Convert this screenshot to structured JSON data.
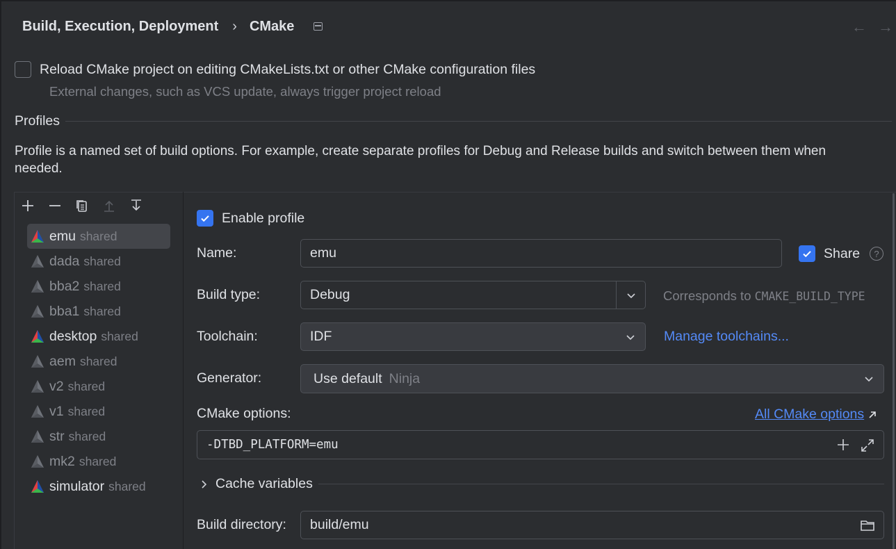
{
  "header": {
    "breadcrumb_parent": "Build, Execution, Deployment",
    "breadcrumb_sep": "›",
    "breadcrumb_current": "CMake",
    "back_arrow": "←",
    "forward_arrow": "→"
  },
  "reload": {
    "label": "Reload CMake project on editing CMakeLists.txt or other CMake configuration files",
    "checked": false,
    "hint": "External changes, such as VCS update, always trigger project reload"
  },
  "profiles": {
    "section_title": "Profiles",
    "description": "Profile is a named set of build options. For example, create separate profiles for Debug and Release builds and switch between them when needed.",
    "toolbar_icons": [
      "add-icon",
      "remove-icon",
      "copy-icon",
      "move-up-icon",
      "move-down-icon"
    ],
    "items": [
      {
        "name": "emu",
        "tag": "shared",
        "enabled": true,
        "selected": true
      },
      {
        "name": "dada",
        "tag": "shared",
        "enabled": false
      },
      {
        "name": "bba2",
        "tag": "shared",
        "enabled": false
      },
      {
        "name": "bba1",
        "tag": "shared",
        "enabled": false
      },
      {
        "name": "desktop",
        "tag": "shared",
        "enabled": true
      },
      {
        "name": "aem",
        "tag": "shared",
        "enabled": false
      },
      {
        "name": "v2",
        "tag": "shared",
        "enabled": false
      },
      {
        "name": "v1",
        "tag": "shared",
        "enabled": false
      },
      {
        "name": "str",
        "tag": "shared",
        "enabled": false
      },
      {
        "name": "mk2",
        "tag": "shared",
        "enabled": false
      },
      {
        "name": "simulator",
        "tag": "shared",
        "enabled": true
      }
    ]
  },
  "form": {
    "enable_label": "Enable profile",
    "enable_checked": true,
    "name_label": "Name:",
    "name_value": "emu",
    "share_label": "Share",
    "share_checked": true,
    "help_glyph": "?",
    "build_type_label": "Build type:",
    "build_type_value": "Debug",
    "build_type_hint_prefix": "Corresponds to",
    "build_type_hint_code": "CMAKE_BUILD_TYPE",
    "toolchain_label": "Toolchain:",
    "toolchain_value": "IDF",
    "manage_toolchains": "Manage toolchains...",
    "generator_label": "Generator:",
    "generator_value": "Use default",
    "generator_hint": "Ninja",
    "cmake_options_label": "CMake options:",
    "all_cmake_options": "All CMake options",
    "cmake_options_value": "-DTBD_PLATFORM=emu",
    "cache_variables_label": "Cache variables",
    "build_dir_label": "Build directory:",
    "build_dir_value": "build/emu"
  },
  "colors": {
    "accent": "#3574f0",
    "link": "#548af7",
    "background": "#2b2d30"
  }
}
